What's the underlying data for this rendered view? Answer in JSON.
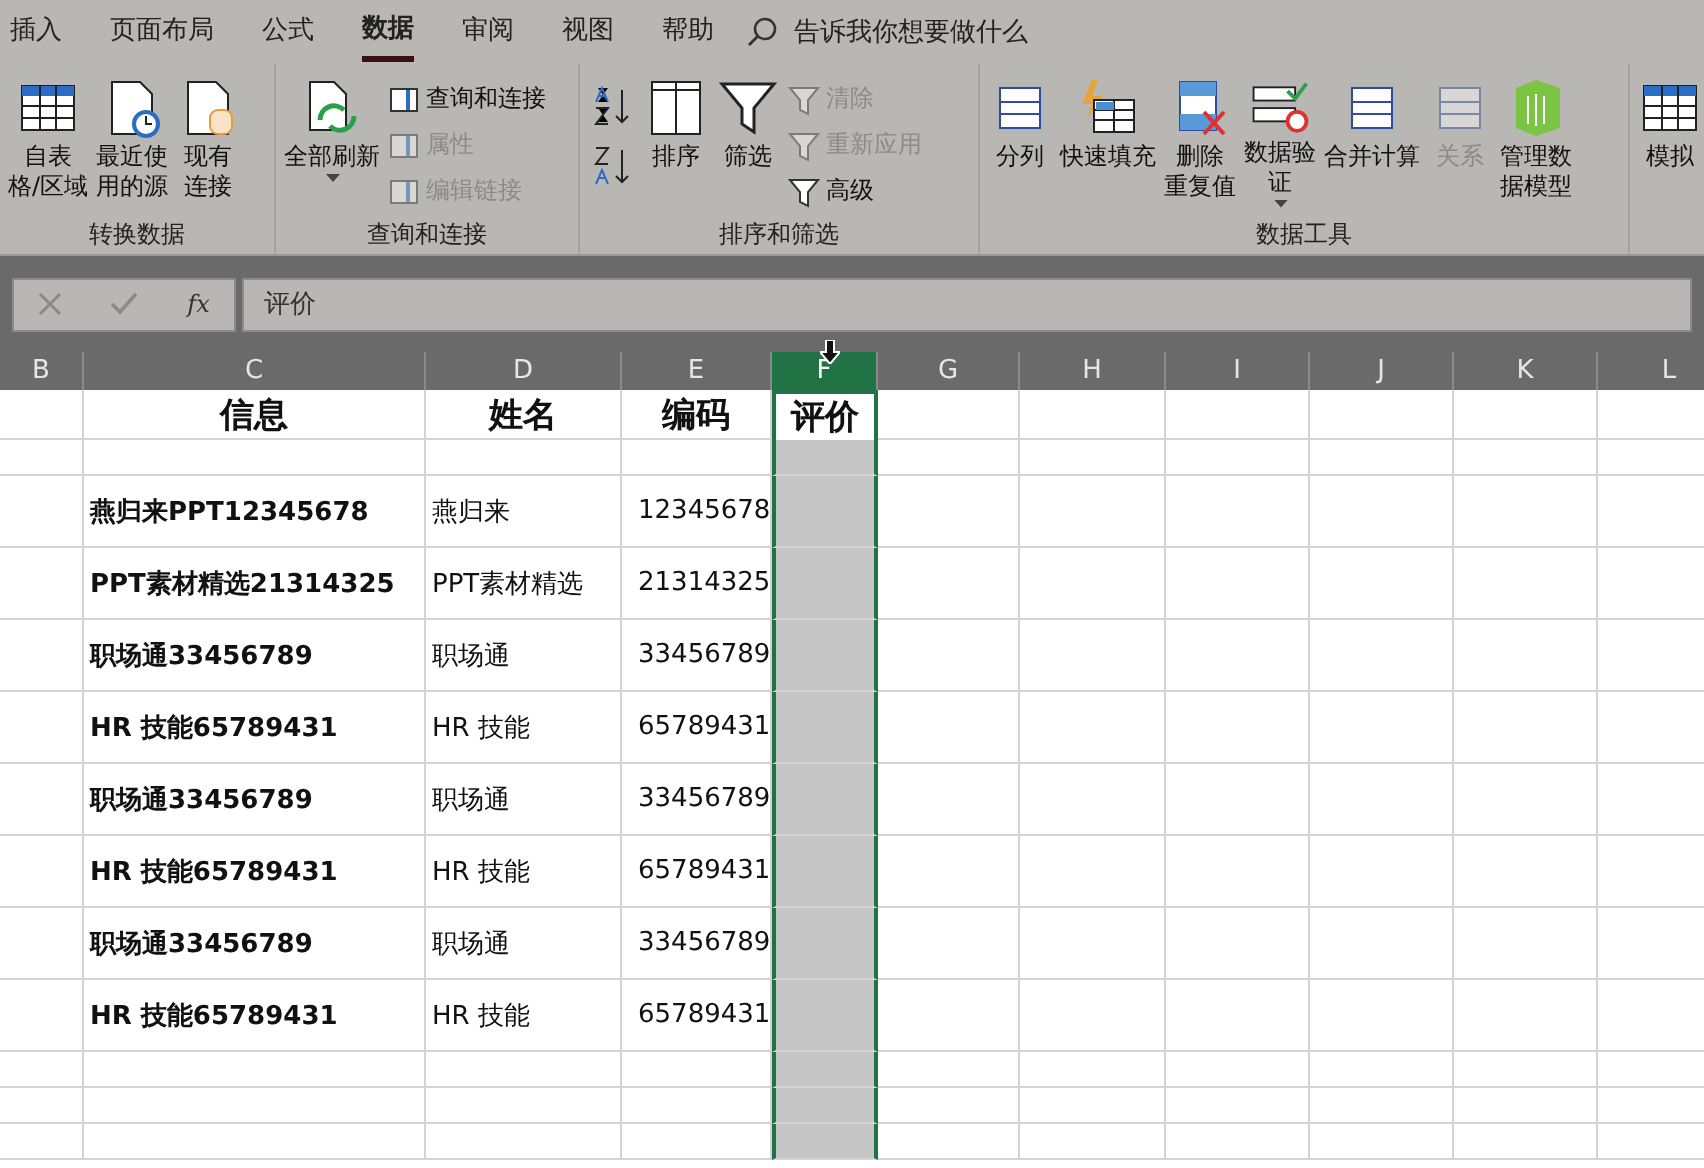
{
  "tabs": [
    {
      "label": "插入",
      "selected": false
    },
    {
      "label": "页面布局",
      "selected": false
    },
    {
      "label": "公式",
      "selected": false
    },
    {
      "label": "数据",
      "selected": true
    },
    {
      "label": "审阅",
      "selected": false
    },
    {
      "label": "视图",
      "selected": false
    },
    {
      "label": "帮助",
      "selected": false
    }
  ],
  "tell_me": "告诉我你想要做什么",
  "groups": [
    {
      "label": "转换数据",
      "buttons": [
        {
          "kind": "large",
          "lines": [
            "自表",
            "格/区域"
          ],
          "disabled": false
        },
        {
          "kind": "large",
          "lines": [
            "最近使",
            "用的源"
          ],
          "disabled": false
        },
        {
          "kind": "large",
          "lines": [
            "现有",
            "连接"
          ],
          "disabled": false
        }
      ]
    },
    {
      "label": "查询和连接",
      "buttons": [
        {
          "kind": "large",
          "lines": [
            "全部刷新"
          ],
          "disabled": false,
          "dropdown": true
        },
        {
          "kind": "small",
          "label": "查询和连接",
          "disabled": false
        },
        {
          "kind": "small",
          "label": "属性",
          "disabled": true
        },
        {
          "kind": "small",
          "label": "编辑链接",
          "disabled": true
        }
      ]
    },
    {
      "label": "排序和筛选",
      "buttons": [
        {
          "kind": "sortpair"
        },
        {
          "kind": "large",
          "lines": [
            "排序"
          ],
          "disabled": false
        },
        {
          "kind": "large",
          "lines": [
            "筛选"
          ],
          "disabled": false
        },
        {
          "kind": "small",
          "label": "清除",
          "disabled": true
        },
        {
          "kind": "small",
          "label": "重新应用",
          "disabled": true
        },
        {
          "kind": "small",
          "label": "高级",
          "disabled": false
        }
      ]
    },
    {
      "label": "数据工具",
      "buttons": [
        {
          "kind": "large",
          "lines": [
            "分列"
          ],
          "disabled": false
        },
        {
          "kind": "large",
          "lines": [
            "快速填充"
          ],
          "disabled": false
        },
        {
          "kind": "large",
          "lines": [
            "删除",
            "重复值"
          ],
          "disabled": false
        },
        {
          "kind": "large",
          "lines": [
            "数据验",
            "证"
          ],
          "disabled": false,
          "dropdown": true
        },
        {
          "kind": "large",
          "lines": [
            "合并计算"
          ],
          "disabled": false
        },
        {
          "kind": "large",
          "lines": [
            "关系"
          ],
          "disabled": true
        },
        {
          "kind": "large",
          "lines": [
            "管理数",
            "据模型"
          ],
          "disabled": false
        }
      ]
    },
    {
      "buttons": [
        {
          "kind": "large",
          "lines": [
            "模拟"
          ],
          "disabled": false
        }
      ]
    }
  ],
  "formula_bar": {
    "function_label": "fx",
    "value": "评价"
  },
  "columns": [
    {
      "label": "B",
      "selected": false
    },
    {
      "label": "C",
      "selected": false
    },
    {
      "label": "D",
      "selected": false
    },
    {
      "label": "E",
      "selected": false
    },
    {
      "label": "F",
      "selected": true
    },
    {
      "label": "G",
      "selected": false
    },
    {
      "label": "H",
      "selected": false
    },
    {
      "label": "I",
      "selected": false
    },
    {
      "label": "J",
      "selected": false
    },
    {
      "label": "K",
      "selected": false
    },
    {
      "label": "L",
      "selected": false
    }
  ],
  "header": [
    "信息",
    "姓名",
    "编码",
    "评价"
  ],
  "rows": [
    {
      "info": "燕归来PPT12345678",
      "name": "燕归来",
      "code": "12345678"
    },
    {
      "info": "PPT素材精选21314325",
      "name": "PPT素材精选",
      "code": "21314325"
    },
    {
      "info": "职场通33456789",
      "name": "职场通",
      "code": "33456789"
    },
    {
      "info": "HR 技能65789431",
      "name": "HR 技能",
      "code": "65789431"
    },
    {
      "info": "职场通33456789",
      "name": "职场通",
      "code": "33456789"
    },
    {
      "info": "HR 技能65789431",
      "name": "HR 技能",
      "code": "65789431"
    },
    {
      "info": "职场通33456789",
      "name": "职场通",
      "code": "33456789"
    },
    {
      "info": "HR 技能65789431",
      "name": "HR 技能",
      "code": "65789431"
    }
  ]
}
